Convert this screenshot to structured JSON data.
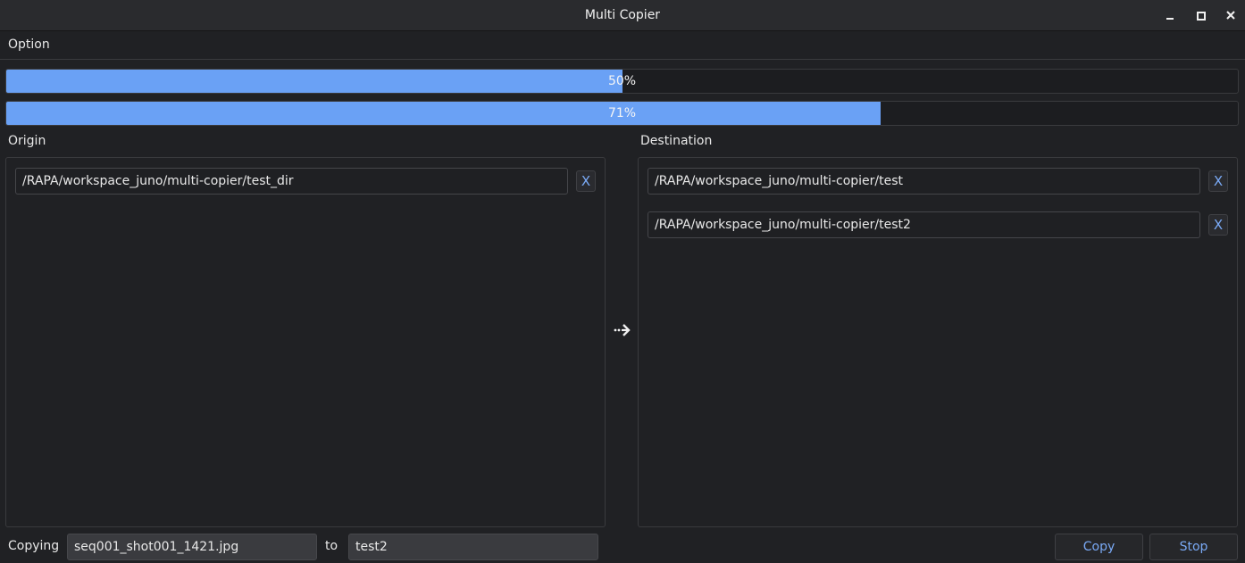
{
  "window": {
    "title": "Multi Copier"
  },
  "menu": {
    "items": [
      {
        "label": "Option"
      }
    ]
  },
  "progress": [
    {
      "text": "50%",
      "fraction": 0.5
    },
    {
      "text": "71%",
      "fraction": 0.71
    }
  ],
  "origin": {
    "label": "Origin",
    "paths": [
      {
        "value": "/RAPA/workspace_juno/multi-copier/test_dir",
        "remove_label": "X"
      }
    ]
  },
  "destination": {
    "label": "Destination",
    "paths": [
      {
        "value": "/RAPA/workspace_juno/multi-copier/test",
        "remove_label": "X"
      },
      {
        "value": "/RAPA/workspace_juno/multi-copier/test2",
        "remove_label": "X"
      }
    ]
  },
  "status": {
    "copying_label": "Copying",
    "current_file": "seq001_shot001_1421.jpg",
    "to_label": "to",
    "current_destination": "test2"
  },
  "actions": {
    "copy_label": "Copy",
    "stop_label": "Stop"
  },
  "colors": {
    "accent": "#6aa1f5",
    "background": "#202124"
  },
  "icons": {
    "transfer": "arrow-right-icon",
    "window_controls": [
      "minimize-icon",
      "maximize-icon",
      "close-icon"
    ]
  }
}
